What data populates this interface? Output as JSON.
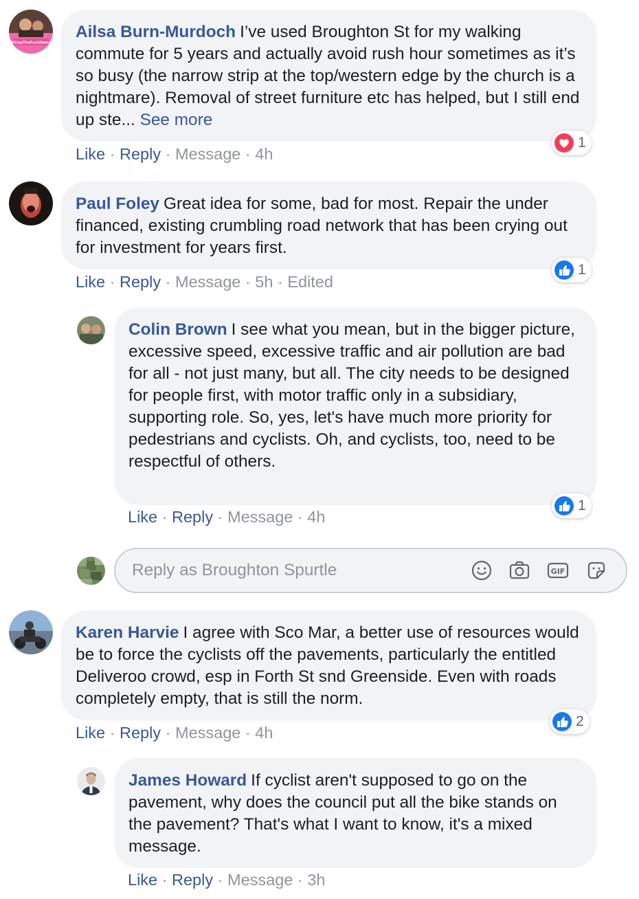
{
  "action_labels": {
    "like": "Like",
    "reply": "Reply",
    "message": "Message",
    "separator": "·"
  },
  "comments": [
    {
      "author": "Ailsa Burn-Murdoch",
      "text": "I’ve used Broughton St for my walking commute for 5 years and actually avoid rush hour sometimes as it’s so busy (the narrow strip at the top/western edge by the church is a nightmare). Removal of street furniture etc has helped, but I still end up ste...",
      "see_more": "See more",
      "time": "4h",
      "reaction": {
        "type": "love",
        "count": "1"
      },
      "avatar_caption": "#StayTheFuckHome"
    },
    {
      "author": "Paul Foley",
      "text": "Great idea for some, bad for most. Repair the under financed, existing crumbling road network that has been crying out for investment for years first.",
      "time": "5h",
      "edited": "Edited",
      "reaction": {
        "type": "like",
        "count": "1"
      }
    },
    {
      "author": "Colin Brown",
      "text": "I see what you mean, but in the bigger picture, excessive speed, excessive traffic and air pollution are bad for all - not just many, but all. The city needs to be designed for people first, with motor traffic only in a subsidiary, supporting role. So, yes, let's have much more priority for pedestrians and cyclists. Oh, and cyclists, too, need to be respectful of others.",
      "time": "4h",
      "reaction": {
        "type": "like",
        "count": "1"
      }
    },
    {
      "author": "Karen Harvie",
      "text": "I agree with Sco Mar, a better use of resources would be to force the cyclists off the pavements, particularly the entitled Deliveroo crowd, esp in Forth St snd Greenside. Even with roads completely empty, that is still the norm.",
      "time": "4h",
      "reaction": {
        "type": "like",
        "count": "2"
      }
    },
    {
      "author": "James Howard",
      "text": "If cyclist aren't supposed to go on the pavement, why does the council put all the bike stands on the pavement? That's what I want to know, it's a mixed message.",
      "time": "3h"
    }
  ],
  "reply_box": {
    "placeholder": "Reply as Broughton Spurtle",
    "tools": [
      "emoji-icon",
      "camera-icon",
      "gif-icon",
      "sticker-icon"
    ]
  },
  "colors": {
    "link": "#385898",
    "bubble": "#f2f3f5",
    "muted": "#90949c",
    "like_blue": "#1877f2",
    "love_red": "#f33e58"
  }
}
